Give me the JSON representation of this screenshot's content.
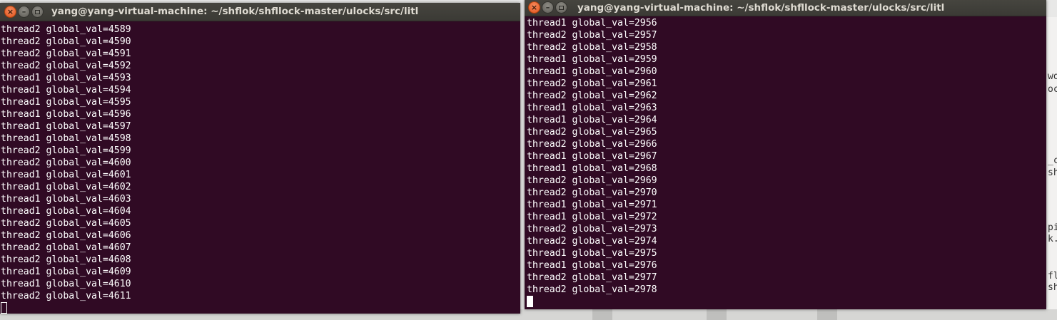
{
  "background": {
    "snippets": [
      "wo",
      "oc",
      "_c",
      "sh",
      "pi",
      "k.",
      "fl",
      "sh"
    ]
  },
  "left_terminal": {
    "title": "yang@yang-virtual-machine: ~/shflok/shfllock-master/ulocks/src/litl",
    "lines": [
      "thread2 global_val=4589",
      "thread2 global_val=4590",
      "thread2 global_val=4591",
      "thread2 global_val=4592",
      "thread1 global_val=4593",
      "thread1 global_val=4594",
      "thread1 global_val=4595",
      "thread1 global_val=4596",
      "thread1 global_val=4597",
      "thread1 global_val=4598",
      "thread2 global_val=4599",
      "thread2 global_val=4600",
      "thread1 global_val=4601",
      "thread1 global_val=4602",
      "thread1 global_val=4603",
      "thread1 global_val=4604",
      "thread2 global_val=4605",
      "thread2 global_val=4606",
      "thread2 global_val=4607",
      "thread2 global_val=4608",
      "thread1 global_val=4609",
      "thread1 global_val=4610",
      "thread2 global_val=4611"
    ]
  },
  "right_terminal": {
    "title": "yang@yang-virtual-machine: ~/shflok/shfllock-master/ulocks/src/litl",
    "lines": [
      "thread1 global_val=2956",
      "thread2 global_val=2957",
      "thread2 global_val=2958",
      "thread1 global_val=2959",
      "thread1 global_val=2960",
      "thread2 global_val=2961",
      "thread2 global_val=2962",
      "thread1 global_val=2963",
      "thread1 global_val=2964",
      "thread2 global_val=2965",
      "thread2 global_val=2966",
      "thread1 global_val=2967",
      "thread1 global_val=2968",
      "thread2 global_val=2969",
      "thread2 global_val=2970",
      "thread1 global_val=2971",
      "thread1 global_val=2972",
      "thread2 global_val=2973",
      "thread2 global_val=2974",
      "thread1 global_val=2975",
      "thread1 global_val=2976",
      "thread2 global_val=2977",
      "thread2 global_val=2978"
    ]
  },
  "colors": {
    "terminal_bg": "#300a24",
    "terminal_fg": "#ffffff",
    "titlebar_bg": "#3c3b37",
    "close_button": "#e2531b"
  },
  "icons": {
    "close": "close-icon",
    "minimize": "minimize-icon",
    "maximize": "maximize-icon"
  }
}
